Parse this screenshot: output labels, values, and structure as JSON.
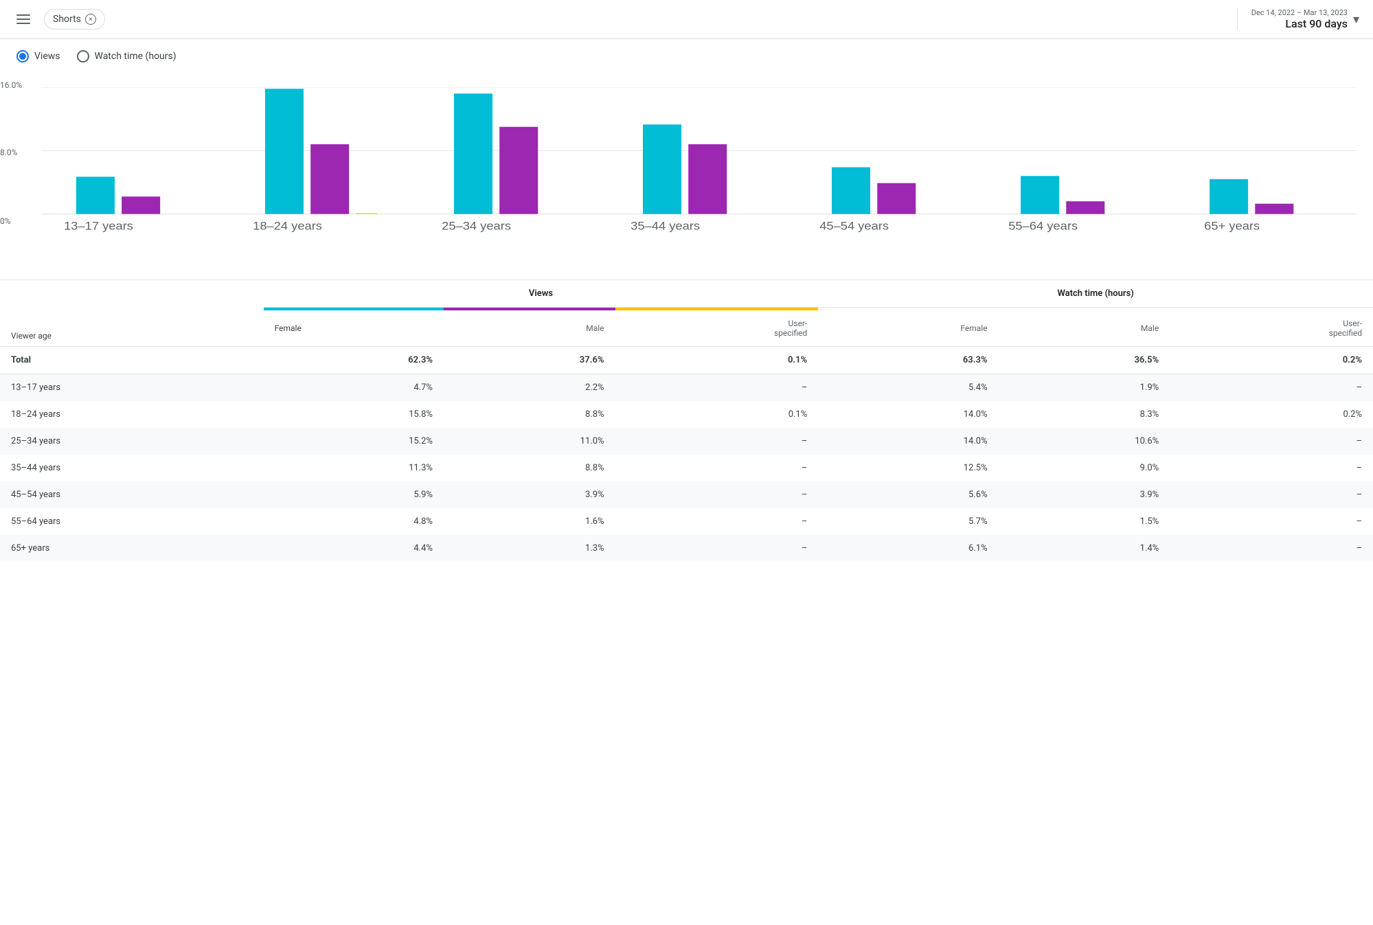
{
  "topbar": {
    "filter_label": "Shorts",
    "filter_close": "×",
    "date_sub": "Dec 14, 2022 – Mar 13, 2023",
    "date_main": "Last 90 days"
  },
  "radio": {
    "views_label": "Views",
    "watch_time_label": "Watch time (hours)",
    "selected": "views"
  },
  "chart": {
    "y_labels": [
      "16.0%",
      "8.0%",
      "0%"
    ],
    "x_labels": [
      "13–17 years",
      "18–24 years",
      "25–34 years",
      "35–44 years",
      "45–54 years",
      "55–64 years",
      "65+ years"
    ],
    "female_color": "#00bcd4",
    "male_color": "#9c27b0",
    "user_color": "#ffc107",
    "bars": [
      {
        "group": "13–17 years",
        "female": 4.7,
        "male": 2.2,
        "user": 0
      },
      {
        "group": "18–24 years",
        "female": 15.8,
        "male": 8.8,
        "user": 0.1
      },
      {
        "group": "25–34 years",
        "female": 15.2,
        "male": 11.0,
        "user": 0
      },
      {
        "group": "35–44 years",
        "female": 11.3,
        "male": 8.8,
        "user": 0
      },
      {
        "group": "45–54 years",
        "female": 5.9,
        "male": 3.9,
        "user": 0
      },
      {
        "group": "55–64 years",
        "female": 4.8,
        "male": 1.6,
        "user": 0
      },
      {
        "group": "65+ years",
        "female": 4.4,
        "male": 1.3,
        "user": 0
      }
    ]
  },
  "table": {
    "col_views": "Views",
    "col_watch": "Watch time (hours)",
    "col_female": "Female",
    "col_male": "Male",
    "col_user_specified": "User-specified",
    "row_viewer_age": "Viewer age",
    "rows": [
      {
        "label": "Total",
        "is_total": true,
        "views_female": "62.3%",
        "views_male": "37.6%",
        "views_user": "0.1%",
        "watch_female": "63.3%",
        "watch_male": "36.5%",
        "watch_user": "0.2%"
      },
      {
        "label": "13–17 years",
        "views_female": "4.7%",
        "views_male": "2.2%",
        "views_user": "–",
        "watch_female": "5.4%",
        "watch_male": "1.9%",
        "watch_user": "–"
      },
      {
        "label": "18–24 years",
        "views_female": "15.8%",
        "views_male": "8.8%",
        "views_user": "0.1%",
        "watch_female": "14.0%",
        "watch_male": "8.3%",
        "watch_user": "0.2%"
      },
      {
        "label": "25–34 years",
        "views_female": "15.2%",
        "views_male": "11.0%",
        "views_user": "–",
        "watch_female": "14.0%",
        "watch_male": "10.6%",
        "watch_user": "–"
      },
      {
        "label": "35–44 years",
        "views_female": "11.3%",
        "views_male": "8.8%",
        "views_user": "–",
        "watch_female": "12.5%",
        "watch_male": "9.0%",
        "watch_user": "–"
      },
      {
        "label": "45–54 years",
        "views_female": "5.9%",
        "views_male": "3.9%",
        "views_user": "–",
        "watch_female": "5.6%",
        "watch_male": "3.9%",
        "watch_user": "–"
      },
      {
        "label": "55–64 years",
        "views_female": "4.8%",
        "views_male": "1.6%",
        "views_user": "–",
        "watch_female": "5.7%",
        "watch_male": "1.5%",
        "watch_user": "–"
      },
      {
        "label": "65+ years",
        "views_female": "4.4%",
        "views_male": "1.3%",
        "views_user": "–",
        "watch_female": "6.1%",
        "watch_male": "1.4%",
        "watch_user": "–"
      }
    ]
  }
}
